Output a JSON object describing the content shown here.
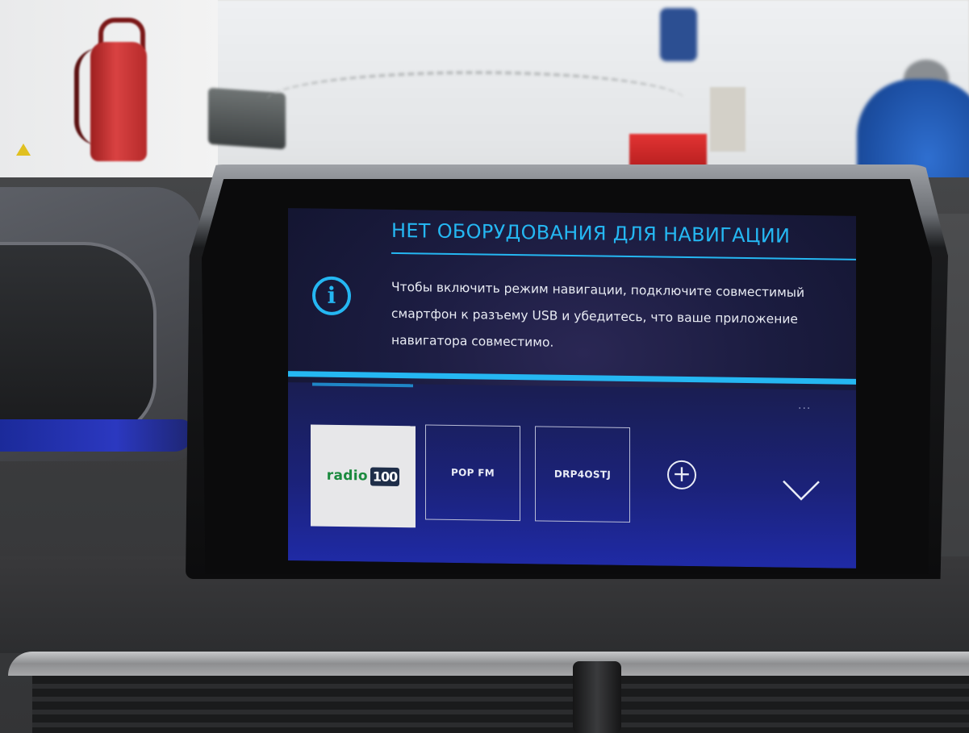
{
  "screen": {
    "title": "НЕТ ОБОРУДОВАНИЯ ДЛЯ НАВИГАЦИИ",
    "message": "Чтобы включить режим навигации, подключите совместимый смартфон к разъему USB и убедитесь, что ваше приложение навигатора совместимо.",
    "icon": "info-icon",
    "page_dots": "...",
    "presets": [
      {
        "logo_word": "radio",
        "logo_number": "100"
      },
      {
        "label": "POP FM"
      },
      {
        "label": "DRP4OSTJ"
      }
    ],
    "add_icon": "+",
    "expand_icon": "chevron-down-icon"
  },
  "colors": {
    "accent": "#25b7f2",
    "screen_bg": "#1b1c40",
    "text": "#e8ebf3"
  }
}
